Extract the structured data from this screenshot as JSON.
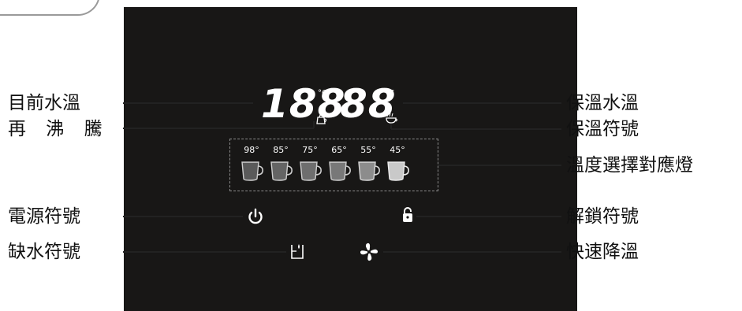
{
  "labels": {
    "current_temp": "目前水溫",
    "reboil": "再 沸 騰",
    "power": "電源符號",
    "low_water": "缺水符號",
    "keepwarm_temp": "保溫水溫",
    "keepwarm_symbol": "保溫符號",
    "temp_lights": "溫度選擇對應燈",
    "unlock": "解鎖符號",
    "fast_cool": "快速降溫"
  },
  "display": {
    "current_digits": "188",
    "keepwarm_digits": "88",
    "unit": "°C"
  },
  "temps": [
    "98°",
    "85°",
    "75°",
    "65°",
    "55°",
    "45°"
  ],
  "colors": {
    "panel": "#181716",
    "cup_dark": "#6f6f6f",
    "cup_light": "#d8d8d8"
  },
  "icons": {
    "kettle": "reboil-kettle-icon",
    "steam_cup": "keep-warm-cup-icon",
    "power": "power-icon",
    "lock": "unlock-icon",
    "water": "low-water-icon",
    "fan": "fan-icon"
  }
}
